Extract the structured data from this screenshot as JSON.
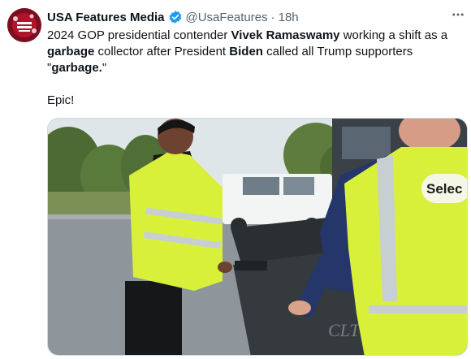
{
  "tweet": {
    "display_name": "USA Features Media",
    "handle": "@UsaFeatures",
    "separator": "·",
    "time": "18h",
    "more_icon": "ellipsis-icon",
    "verified_icon": "verified-badge-icon",
    "text": {
      "part1": "2024 GOP presidential contender ",
      "bold1": "Vivek Ramaswamy",
      "part2": " working a shift as a ",
      "bold2": "garbage",
      "part3": " collector after President ",
      "bold3": "Biden",
      "part4": " called all Trump supporters \"",
      "bold4": "garbage.",
      "part5": "\"",
      "line2": "Epic!"
    },
    "media": {
      "vest_text_top": "Selec",
      "bin_text": "CLT"
    }
  },
  "colors": {
    "verified_blue": "#1d9bf0",
    "secondary_text": "#536471",
    "vest_yellow": "#d8f03a"
  }
}
